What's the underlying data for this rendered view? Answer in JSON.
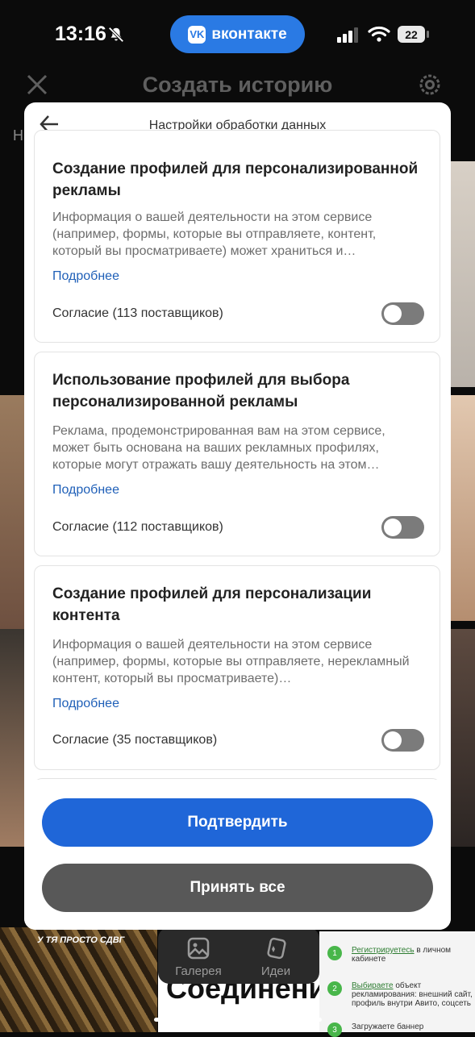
{
  "status_bar": {
    "time": "13:16",
    "app_pill_label": "вконтакте",
    "battery": "22"
  },
  "background": {
    "title": "Создать историю",
    "partial_label": "Н",
    "tabs": [
      {
        "label": "Галерея"
      },
      {
        "label": "Идеи"
      }
    ],
    "bottom_left_text": "У ТЯ ПРОСТО СДВГ",
    "big_word": "Соединени",
    "steps": [
      {
        "num": "1",
        "link": "Регистрируетесь",
        "text": " в личном кабинете"
      },
      {
        "num": "2",
        "link": "Выбираете",
        "text": " объект рекламирования: внешний сайт, профиль внутри Авито, соцсеть"
      },
      {
        "num": "3",
        "link": "",
        "text": "Загружаете баннер"
      }
    ]
  },
  "modal": {
    "title": "Настройки обработки данных",
    "cards": [
      {
        "title": "Создание профилей для персонализированной рекламы",
        "description": "Информация о вашей деятельности на этом сервисе (например, формы, которые вы отправляете, контент, который вы просматриваете) может храниться и…",
        "link": "Подробнее",
        "consent": "Согласие (113 поставщиков)",
        "enabled": false
      },
      {
        "title": "Использование профилей для выбора персонализированной рекламы",
        "description": "Реклама, продемонстрированная вам на этом сервисе, может быть основана на ваших рекламных профилях, которые могут отражать вашу деятельность на этом…",
        "link": "Подробнее",
        "consent": "Согласие (112 поставщиков)",
        "enabled": false
      },
      {
        "title": "Создание профилей для персонализации контента",
        "description": "Информация о вашей деятельности на этом сервисе (например, формы, которые вы отправляете, нерекламный контент, который вы просматриваете)…",
        "link": "Подробнее",
        "consent": "Согласие (35 поставщиков)",
        "enabled": false
      }
    ],
    "confirm_label": "Подтвердить",
    "accept_all_label": "Принять все"
  },
  "colors": {
    "primary": "#1f66d8",
    "secondary_button": "#585858",
    "link": "#2060b8",
    "toggle_off": "#7b7b7b",
    "vk_blue": "#2a7ae4"
  }
}
